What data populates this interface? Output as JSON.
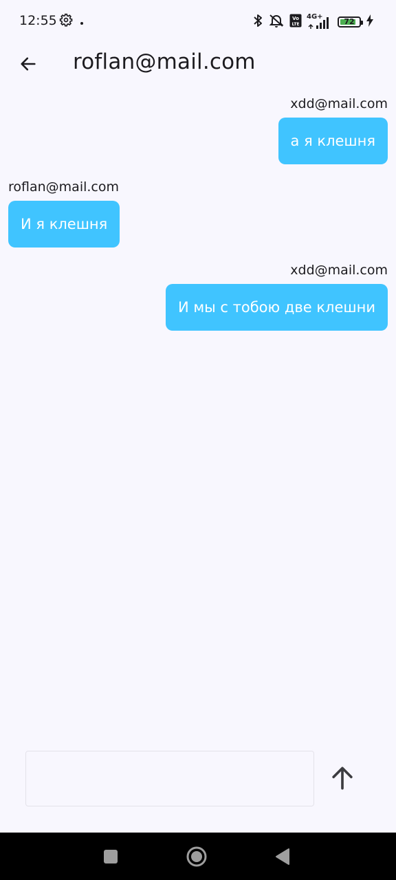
{
  "status_bar": {
    "time": "12:55",
    "battery_level": "72",
    "network": "4G+",
    "volte": "Vo LTE"
  },
  "app_bar": {
    "title": "roflan@mail.com",
    "back_icon": "arrow-left-icon"
  },
  "messages": [
    {
      "sender": "xdd@mail.com",
      "text": "а я клешня",
      "direction": "outgoing"
    },
    {
      "sender": "roflan@mail.com",
      "text": "И я клешня",
      "direction": "incoming"
    },
    {
      "sender": "xdd@mail.com",
      "text": "И мы с тобою две клешни",
      "direction": "outgoing"
    }
  ],
  "composer": {
    "value": "",
    "placeholder": "",
    "send_icon": "arrow-up-icon"
  },
  "nav_bar": {
    "recents_icon": "square-icon",
    "home_icon": "circle-icon",
    "back_icon": "triangle-back-icon"
  },
  "colors": {
    "background": "#f8f7fe",
    "bubble": "#40c4ff",
    "bubble_text": "#ffffff",
    "battery": "#4caf50"
  }
}
